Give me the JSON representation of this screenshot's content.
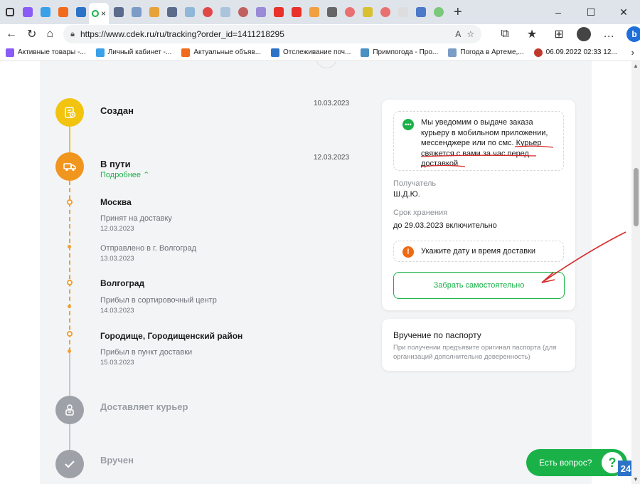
{
  "browser": {
    "url": "https://www.cdek.ru/ru/tracking?order_id=1411218295",
    "active_tab_close": "×",
    "new_tab": "+",
    "window_controls": [
      "–",
      "☐",
      "✕"
    ]
  },
  "bookmarks": [
    {
      "label": "Активные товары -...",
      "color": "#8a5cf5"
    },
    {
      "label": "Личный кабинет -...",
      "color": "#3aa0e8"
    },
    {
      "label": "Актуальные объяв...",
      "color": "#f26b1d"
    },
    {
      "label": "Отслеживание поч...",
      "color": "#2c73c8"
    },
    {
      "label": "Примпогода - Про...",
      "color": "#4a90c0"
    },
    {
      "label": "Погода в Артеме,...",
      "color": "#7a9cc6"
    },
    {
      "label": "06.09.2022 02:33 12...",
      "color": "#c0392b"
    }
  ],
  "steps": [
    {
      "title": "Создан",
      "date": "10.03.2023"
    },
    {
      "title": "В пути",
      "date": "12.03.2023",
      "more": "Подробнее"
    },
    {
      "title": "Доставляет курьер"
    },
    {
      "title": "Вручен"
    }
  ],
  "history": [
    {
      "city": "Москва",
      "events": [
        {
          "text": "Принят на доставку",
          "date": "12.03.2023"
        },
        {
          "text": "Отправлено в г. Волгоград",
          "date": "13.03.2023"
        }
      ]
    },
    {
      "city": "Волгоград",
      "events": [
        {
          "text": "Прибыл в сортировочный центр",
          "date": "14.03.2023"
        }
      ]
    },
    {
      "city": "Городище, Городищенский район",
      "events": [
        {
          "text": "Прибыл в пункт доставки",
          "date": "15.03.2023"
        }
      ]
    }
  ],
  "info": {
    "note_line1": "Мы уведомим о выдаче заказа",
    "note_line2": "курьеру в мобильном приложении,",
    "note_line3": "мессенджере или по смс.",
    "note_line3b": "Курьер",
    "note_line4": "свяжется с вами за час перед",
    "note_line5": "доставкой",
    "recipient_label": "Получатель",
    "recipient_value": "Ш.Д.Ю.",
    "storage_label": "Срок хранения",
    "storage_value": "до 29.03.2023 включительно",
    "warning": "Укажите дату и время доставки",
    "pickup_button": "Забрать самостоятельно"
  },
  "passport": {
    "title": "Вручение по паспорту",
    "description": "При получении предъявите оригинал паспорта (для организаций дополнительно доверенность)"
  },
  "chat": {
    "label": "Есть вопрос?",
    "icon": "?",
    "badge": "24"
  },
  "colors": {
    "brand_green": "#1ab248",
    "created_yellow": "#f2c40f",
    "transit_orange": "#f0961e",
    "inactive_gray": "#9ea2a8",
    "annotation_red": "#d62b2b"
  }
}
